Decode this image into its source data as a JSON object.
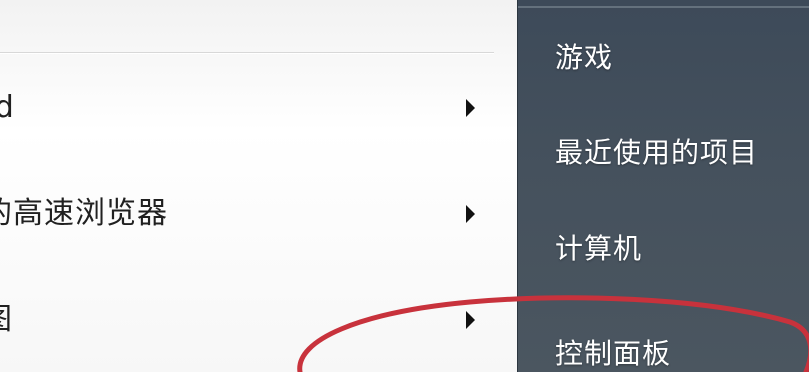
{
  "left_menu": {
    "items": [
      {
        "label": "",
        "has_submenu": false
      },
      {
        "label": "rd",
        "has_submenu": true
      },
      {
        "label": "的高速浏览器",
        "has_submenu": true
      },
      {
        "label": "图",
        "has_submenu": true
      }
    ]
  },
  "right_menu": {
    "items": [
      {
        "label": "游戏"
      },
      {
        "label": "最近使用的项目"
      },
      {
        "label": "计算机"
      },
      {
        "label": "控制面板"
      }
    ]
  },
  "annotation": {
    "type": "ellipse",
    "color": "#c8323c",
    "target": "控制面板"
  },
  "colors": {
    "right_pane_bg": "#45515d",
    "left_pane_bg": "#ffffff"
  }
}
